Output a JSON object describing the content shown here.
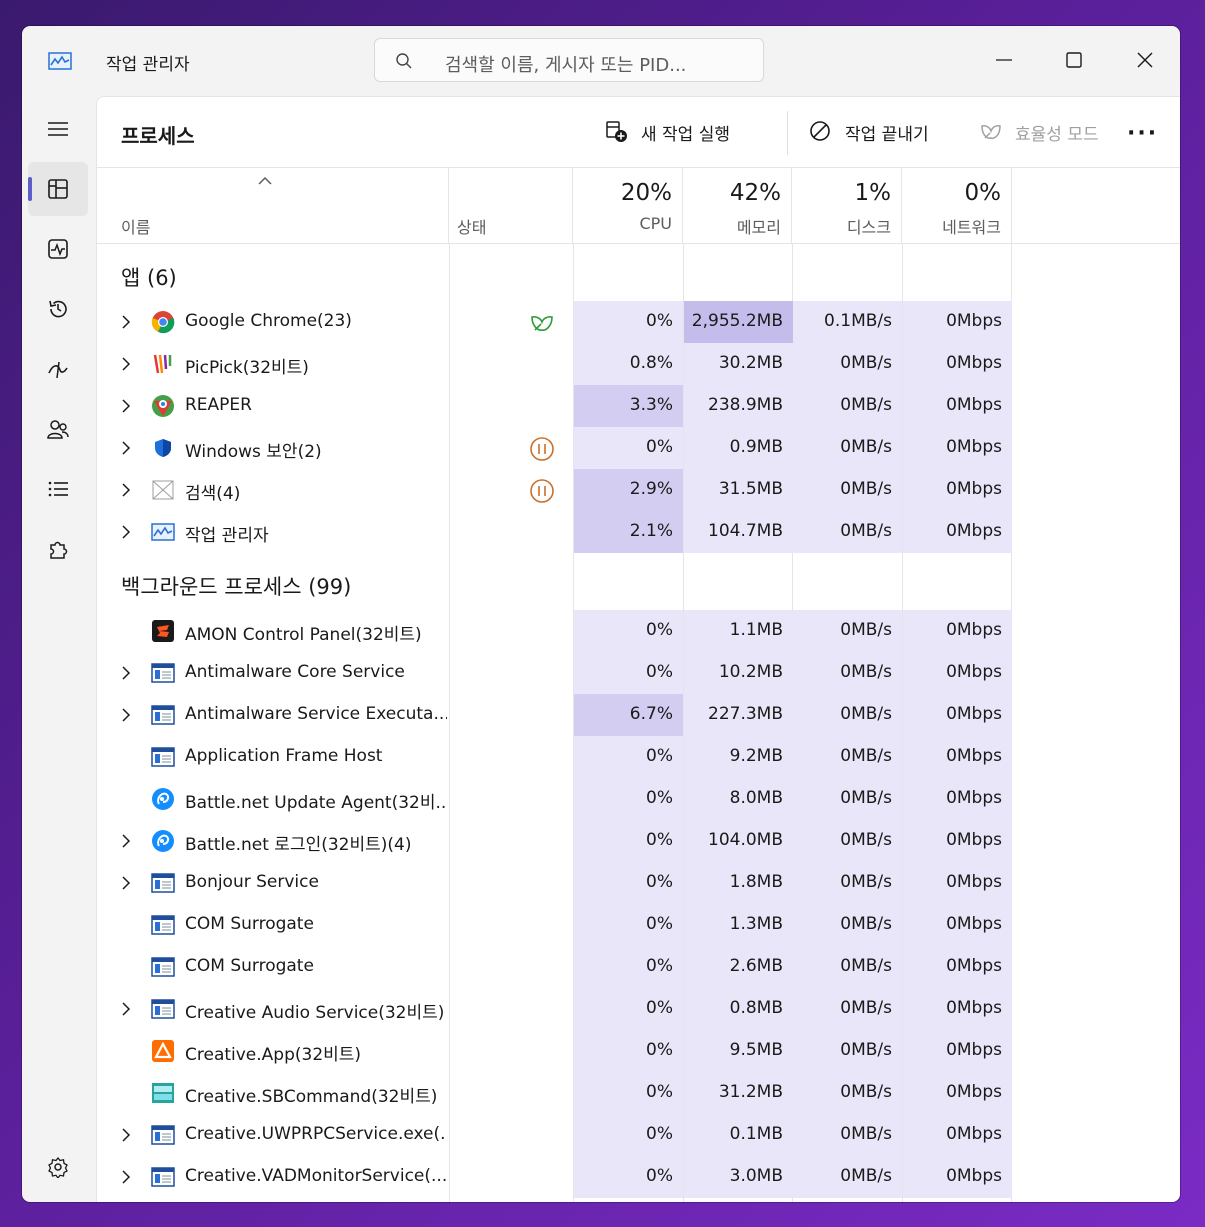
{
  "window": {
    "title": "작업 관리자",
    "search_placeholder": "검색할 이름, 게시자 또는 PID..."
  },
  "toolbar": {
    "page_title": "프로세스",
    "run_new_task": "새 작업 실행",
    "end_task": "작업 끝내기",
    "efficiency_mode": "효율성 모드"
  },
  "columns": {
    "name": "이름",
    "status": "상태",
    "cpu": {
      "pct": "20%",
      "label": "CPU"
    },
    "memory": {
      "pct": "42%",
      "label": "메모리"
    },
    "disk": {
      "pct": "1%",
      "label": "디스크"
    },
    "network": {
      "pct": "0%",
      "label": "네트워크"
    }
  },
  "groups": {
    "apps": "앱 (6)",
    "background": "백그라운드 프로세스 (99)"
  },
  "apps": [
    {
      "name": "Google Chrome(23)",
      "expand": true,
      "icon": "chrome-icon",
      "status": "efficiency-leaf-icon",
      "cpu": "0%",
      "mem": "2,955.2MB",
      "disk": "0.1MB/s",
      "net": "0Mbps",
      "cpu_level": 1,
      "mem_level": 3
    },
    {
      "name": "PicPick(32비트)",
      "expand": true,
      "icon": "picpick-icon",
      "status": "",
      "cpu": "0.8%",
      "mem": "30.2MB",
      "disk": "0MB/s",
      "net": "0Mbps",
      "cpu_level": 1,
      "mem_level": 1
    },
    {
      "name": "REAPER",
      "expand": true,
      "icon": "reaper-icon",
      "status": "",
      "cpu": "3.3%",
      "mem": "238.9MB",
      "disk": "0MB/s",
      "net": "0Mbps",
      "cpu_level": 2,
      "mem_level": 1
    },
    {
      "name": "Windows 보안(2)",
      "expand": true,
      "icon": "shield-icon",
      "status": "suspended-icon",
      "cpu": "0%",
      "mem": "0.9MB",
      "disk": "0MB/s",
      "net": "0Mbps",
      "cpu_level": 1,
      "mem_level": 1
    },
    {
      "name": "검색(4)",
      "expand": true,
      "icon": "search-app-icon",
      "status": "suspended-icon",
      "cpu": "2.9%",
      "mem": "31.5MB",
      "disk": "0MB/s",
      "net": "0Mbps",
      "cpu_level": 2,
      "mem_level": 1
    },
    {
      "name": "작업 관리자",
      "expand": true,
      "icon": "taskmgr-icon",
      "status": "",
      "cpu": "2.1%",
      "mem": "104.7MB",
      "disk": "0MB/s",
      "net": "0Mbps",
      "cpu_level": 2,
      "mem_level": 1
    }
  ],
  "background": [
    {
      "name": "AMON Control Panel(32비트)",
      "expand": false,
      "icon": "amon-icon",
      "cpu": "0%",
      "mem": "1.1MB",
      "disk": "0MB/s",
      "net": "0Mbps",
      "cpu_level": 1
    },
    {
      "name": "Antimalware Core Service",
      "expand": true,
      "icon": "service-window-icon",
      "cpu": "0%",
      "mem": "10.2MB",
      "disk": "0MB/s",
      "net": "0Mbps",
      "cpu_level": 1
    },
    {
      "name": "Antimalware Service Executa...",
      "expand": true,
      "icon": "service-window-icon",
      "cpu": "6.7%",
      "mem": "227.3MB",
      "disk": "0MB/s",
      "net": "0Mbps",
      "cpu_level": 2
    },
    {
      "name": "Application Frame Host",
      "expand": false,
      "icon": "service-window-icon",
      "cpu": "0%",
      "mem": "9.2MB",
      "disk": "0MB/s",
      "net": "0Mbps",
      "cpu_level": 1
    },
    {
      "name": "Battle.net Update Agent(32비...",
      "expand": false,
      "icon": "battlenet-icon",
      "cpu": "0%",
      "mem": "8.0MB",
      "disk": "0MB/s",
      "net": "0Mbps",
      "cpu_level": 1
    },
    {
      "name": "Battle.net 로그인(32비트)(4)",
      "expand": true,
      "icon": "battlenet-icon",
      "cpu": "0%",
      "mem": "104.0MB",
      "disk": "0MB/s",
      "net": "0Mbps",
      "cpu_level": 1
    },
    {
      "name": "Bonjour Service",
      "expand": true,
      "icon": "service-window-icon",
      "cpu": "0%",
      "mem": "1.8MB",
      "disk": "0MB/s",
      "net": "0Mbps",
      "cpu_level": 1
    },
    {
      "name": "COM Surrogate",
      "expand": false,
      "icon": "service-window-icon",
      "cpu": "0%",
      "mem": "1.3MB",
      "disk": "0MB/s",
      "net": "0Mbps",
      "cpu_level": 1
    },
    {
      "name": "COM Surrogate",
      "expand": false,
      "icon": "service-window-icon",
      "cpu": "0%",
      "mem": "2.6MB",
      "disk": "0MB/s",
      "net": "0Mbps",
      "cpu_level": 1
    },
    {
      "name": "Creative Audio Service(32비트)",
      "expand": true,
      "icon": "service-window-icon",
      "cpu": "0%",
      "mem": "0.8MB",
      "disk": "0MB/s",
      "net": "0Mbps",
      "cpu_level": 1
    },
    {
      "name": "Creative.App(32비트)",
      "expand": false,
      "icon": "creative-app-icon",
      "cpu": "0%",
      "mem": "9.5MB",
      "disk": "0MB/s",
      "net": "0Mbps",
      "cpu_level": 1
    },
    {
      "name": "Creative.SBCommand(32비트)",
      "expand": false,
      "icon": "sbcommand-icon",
      "cpu": "0%",
      "mem": "31.2MB",
      "disk": "0MB/s",
      "net": "0Mbps",
      "cpu_level": 1
    },
    {
      "name": "Creative.UWPRPCService.exe(...",
      "expand": true,
      "icon": "service-window-icon",
      "cpu": "0%",
      "mem": "0.1MB",
      "disk": "0MB/s",
      "net": "0Mbps",
      "cpu_level": 1
    },
    {
      "name": "Creative.VADMonitorService(...",
      "expand": true,
      "icon": "service-window-icon",
      "cpu": "0%",
      "mem": "3.0MB",
      "disk": "0MB/s",
      "net": "0Mbps",
      "cpu_level": 1
    }
  ],
  "colors": {
    "accent": "#5b5fc7",
    "heat_low": "#e8e6f8",
    "heat_mid": "#d2cdf1",
    "heat_high": "#c4bdec"
  }
}
